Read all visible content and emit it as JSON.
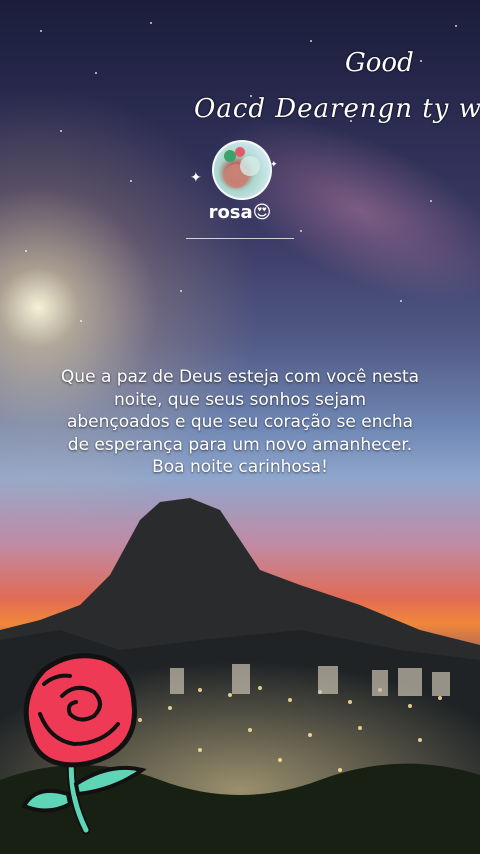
{
  "overlay": {
    "greeting_line1": "Good",
    "greeting_line2": "Oacd Dearengn ty witl"
  },
  "profile": {
    "username": "rosa😍",
    "avatar_icon": "avatar-flower-photo"
  },
  "message": {
    "text": "Que a paz de Deus esteja com você nesta noite, que seus sonhos sejam abençoados e que seu coração se encha de esperança para um novo amanhecer. Boa noite carinhosa!"
  },
  "stickers": {
    "rose_icon": "red-rose-sticker"
  },
  "colors": {
    "rose_red": "#ef3a55",
    "stem": "#5ed6b6",
    "outline": "#111111",
    "text": "#ffffff"
  }
}
